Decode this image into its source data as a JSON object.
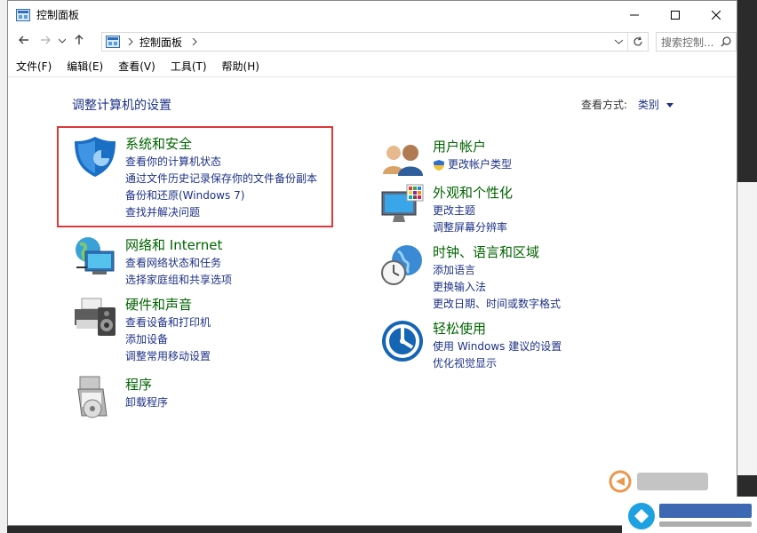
{
  "window": {
    "title": "控制面板"
  },
  "address": {
    "path": "控制面板",
    "search_placeholder": "搜索控制..."
  },
  "menu": [
    "文件(F)",
    "编辑(E)",
    "查看(V)",
    "工具(T)",
    "帮助(H)"
  ],
  "heading": "调整计算机的设置",
  "view_by": {
    "label": "查看方式:",
    "value": "类别"
  },
  "categories": [
    {
      "title": "系统和安全",
      "links": [
        "查看你的计算机状态",
        "通过文件历史记录保存你的文件备份副本",
        "备份和还原(Windows 7)",
        "查找并解决问题"
      ]
    },
    {
      "title": "网络和 Internet",
      "links": [
        "查看网络状态和任务",
        "选择家庭组和共享选项"
      ]
    },
    {
      "title": "硬件和声音",
      "links": [
        "查看设备和打印机",
        "添加设备",
        "调整常用移动设置"
      ]
    },
    {
      "title": "程序",
      "links": [
        "卸载程序"
      ]
    },
    {
      "title": "用户帐户",
      "links": [
        "更改帐户类型"
      ]
    },
    {
      "title": "外观和个性化",
      "links": [
        "更改主题",
        "调整屏幕分辨率"
      ]
    },
    {
      "title": "时钟、语言和区域",
      "links": [
        "添加语言",
        "更换输入法",
        "更改日期、时间或数字格式"
      ]
    },
    {
      "title": "轻松使用",
      "links": [
        "使用 Windows 建议的设置",
        "优化视觉显示"
      ]
    }
  ],
  "colors": {
    "heading": "#1e3287",
    "category_title": "#006400",
    "link": "#1e3287",
    "highlight": "#d9393a"
  }
}
